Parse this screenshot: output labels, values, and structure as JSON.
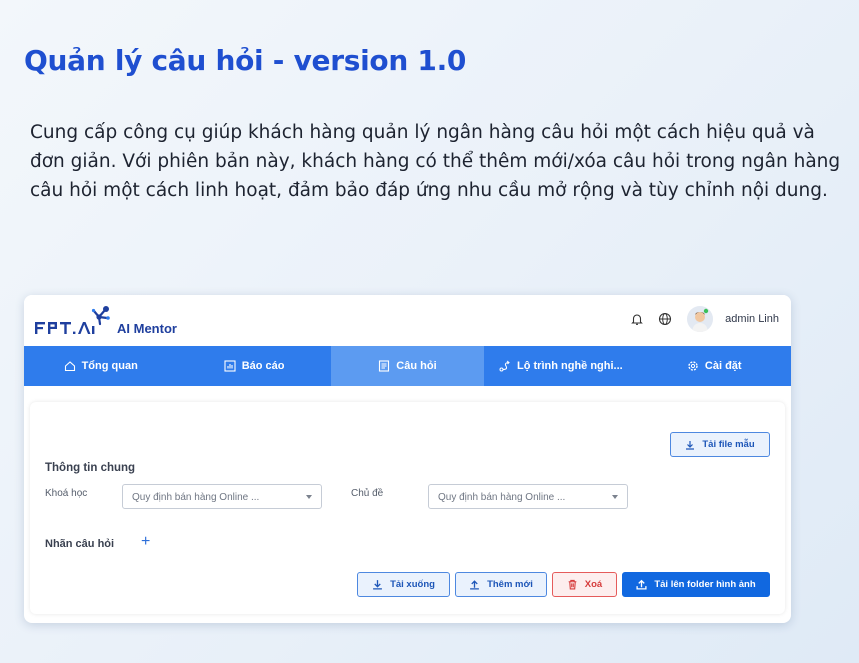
{
  "page": {
    "title": "Quản lý câu hỏi - version 1.0",
    "description": "Cung cấp công cụ giúp khách hàng quản lý ngân hàng câu hỏi một cách hiệu quả và đơn giản. Với phiên bản này, khách hàng có thể thêm mới/xóa câu hỏi trong ngân hàng câu hỏi một cách linh hoạt, đảm bảo đáp ứng nhu cầu mở rộng và tùy chỉnh nội dung."
  },
  "app": {
    "product_name": "AI Mentor",
    "user_name": "admin Linh",
    "colors": {
      "primary": "#2f7cec",
      "nav_active": "#5c9bf1",
      "accent_blue": "#1168e0",
      "danger": "#e55b5b"
    }
  },
  "nav": {
    "items": [
      {
        "label": "Tổng quan",
        "icon": "home-icon"
      },
      {
        "label": "Báo cáo",
        "icon": "chart-icon"
      },
      {
        "label": "Câu hỏi",
        "icon": "document-icon",
        "active": true
      },
      {
        "label": "Lộ trình nghề nghi...",
        "icon": "route-icon"
      },
      {
        "label": "Cài đặt",
        "icon": "gear-icon"
      }
    ]
  },
  "form": {
    "download_template_label": "Tải file mẫu",
    "section_title": "Thông tin chung",
    "course_label": "Khoá học",
    "course_value": "Quy định bán hàng Online ...",
    "topic_label": "Chủ đề",
    "topic_value": "Quy định bán hàng Online ...",
    "tag_label": "Nhãn câu hỏi",
    "add_tag_symbol": "+"
  },
  "actions": {
    "download": "Tải xuống",
    "add_new": "Thêm mới",
    "delete": "Xoá",
    "upload_images": "Tải lên folder hình ảnh"
  }
}
